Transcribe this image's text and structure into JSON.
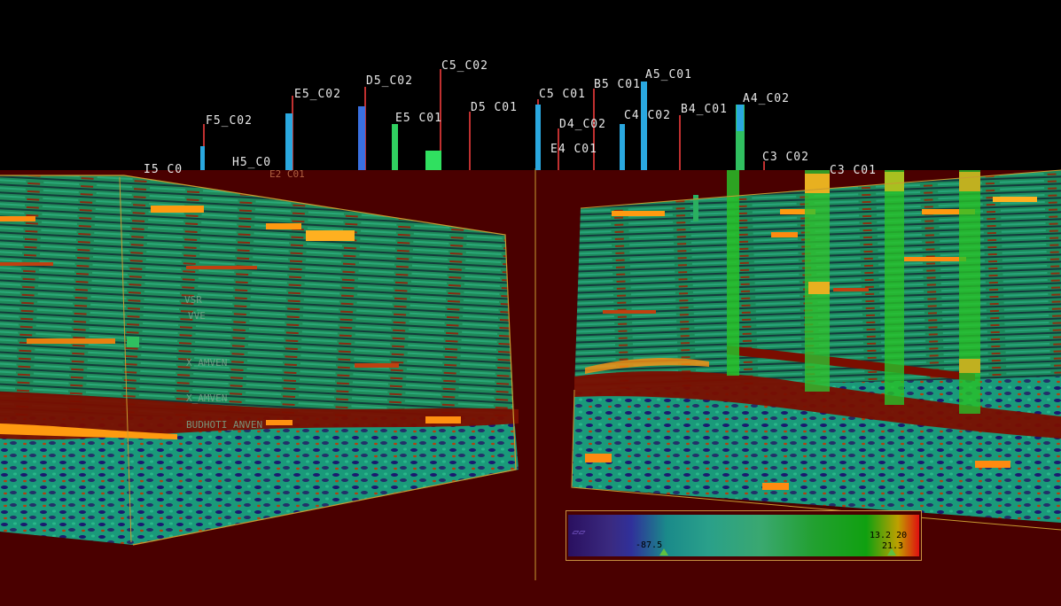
{
  "wells": [
    {
      "label": "C5_C02"
    },
    {
      "label": "A5_C01"
    },
    {
      "label": "D5_C02"
    },
    {
      "label": "B5 C01"
    },
    {
      "label": "E5_C02"
    },
    {
      "label": "C5 C01"
    },
    {
      "label": "D5 C01"
    },
    {
      "label": "A4_C02"
    },
    {
      "label": "B4_C01"
    },
    {
      "label": "E5 C01"
    },
    {
      "label": "F5_C02"
    },
    {
      "label": "D4_C02"
    },
    {
      "label": "C4 C02"
    },
    {
      "label": "E4 C01"
    },
    {
      "label": "H5_C0"
    },
    {
      "label": "I5 C0"
    },
    {
      "label": "C3 C02"
    },
    {
      "label": "C3 C01"
    },
    {
      "label": "E2 C01"
    }
  ],
  "horizons": [
    {
      "label": "VSR"
    },
    {
      "label": "VVE"
    },
    {
      "label": "X_AMVEN"
    },
    {
      "label": "X_AMVEN"
    },
    {
      "label": "BUDHOTI_ANVEN"
    }
  ],
  "colorbar": {
    "min_label": "-87.5",
    "max_label": "13.2 20",
    "mid_label": "21.3"
  },
  "colors": {
    "background": "#000000",
    "ground": "#4a0000",
    "seismic_green": "#1f8a5a",
    "seismic_teal": "#1a9a7a",
    "high_amp": "#ff9a10",
    "low_amp": "#1a1a70",
    "well_blue": "#2aa8e0",
    "well_green": "#30d060",
    "well_stick": "#c03030"
  }
}
